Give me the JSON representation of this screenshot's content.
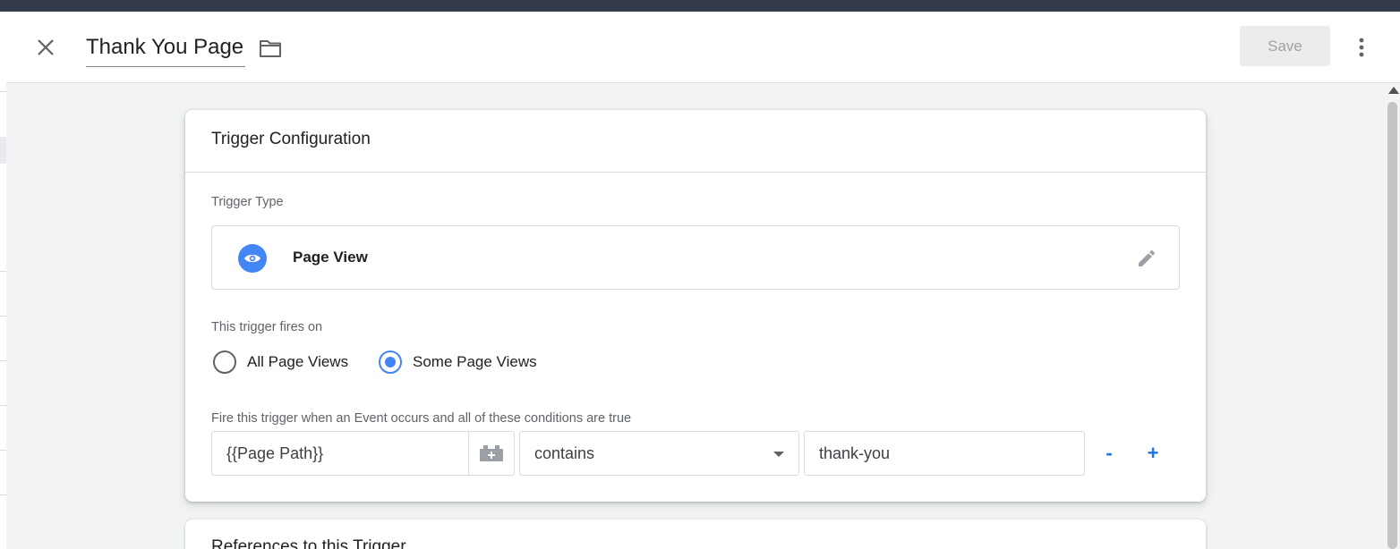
{
  "header": {
    "title": "Thank You Page",
    "save_label": "Save"
  },
  "icons": {
    "close": "close-icon",
    "folder": "folder-icon",
    "more": "more-vert-icon",
    "page_view": "eye-icon",
    "edit": "pencil-icon",
    "variable": "variable-building-block-icon"
  },
  "colors": {
    "accent": "#4285f4",
    "link_blue": "#1a73e8",
    "top_strip": "#333a4a",
    "background": "#f1f3f4"
  },
  "trigger_config": {
    "title": "Trigger Configuration",
    "type_label": "Trigger Type",
    "type_name": "Page View",
    "fires_on_label": "This trigger fires on",
    "options": [
      {
        "label": "All Page Views",
        "selected": false
      },
      {
        "label": "Some Page Views",
        "selected": true
      }
    ],
    "conditions_label": "Fire this trigger when an Event occurs and all of these conditions are true",
    "condition": {
      "variable": "{{Page Path}}",
      "operator": "contains",
      "value": "thank-you"
    },
    "remove_label": "-",
    "add_label": "+"
  },
  "references": {
    "title": "References to this Trigger"
  }
}
